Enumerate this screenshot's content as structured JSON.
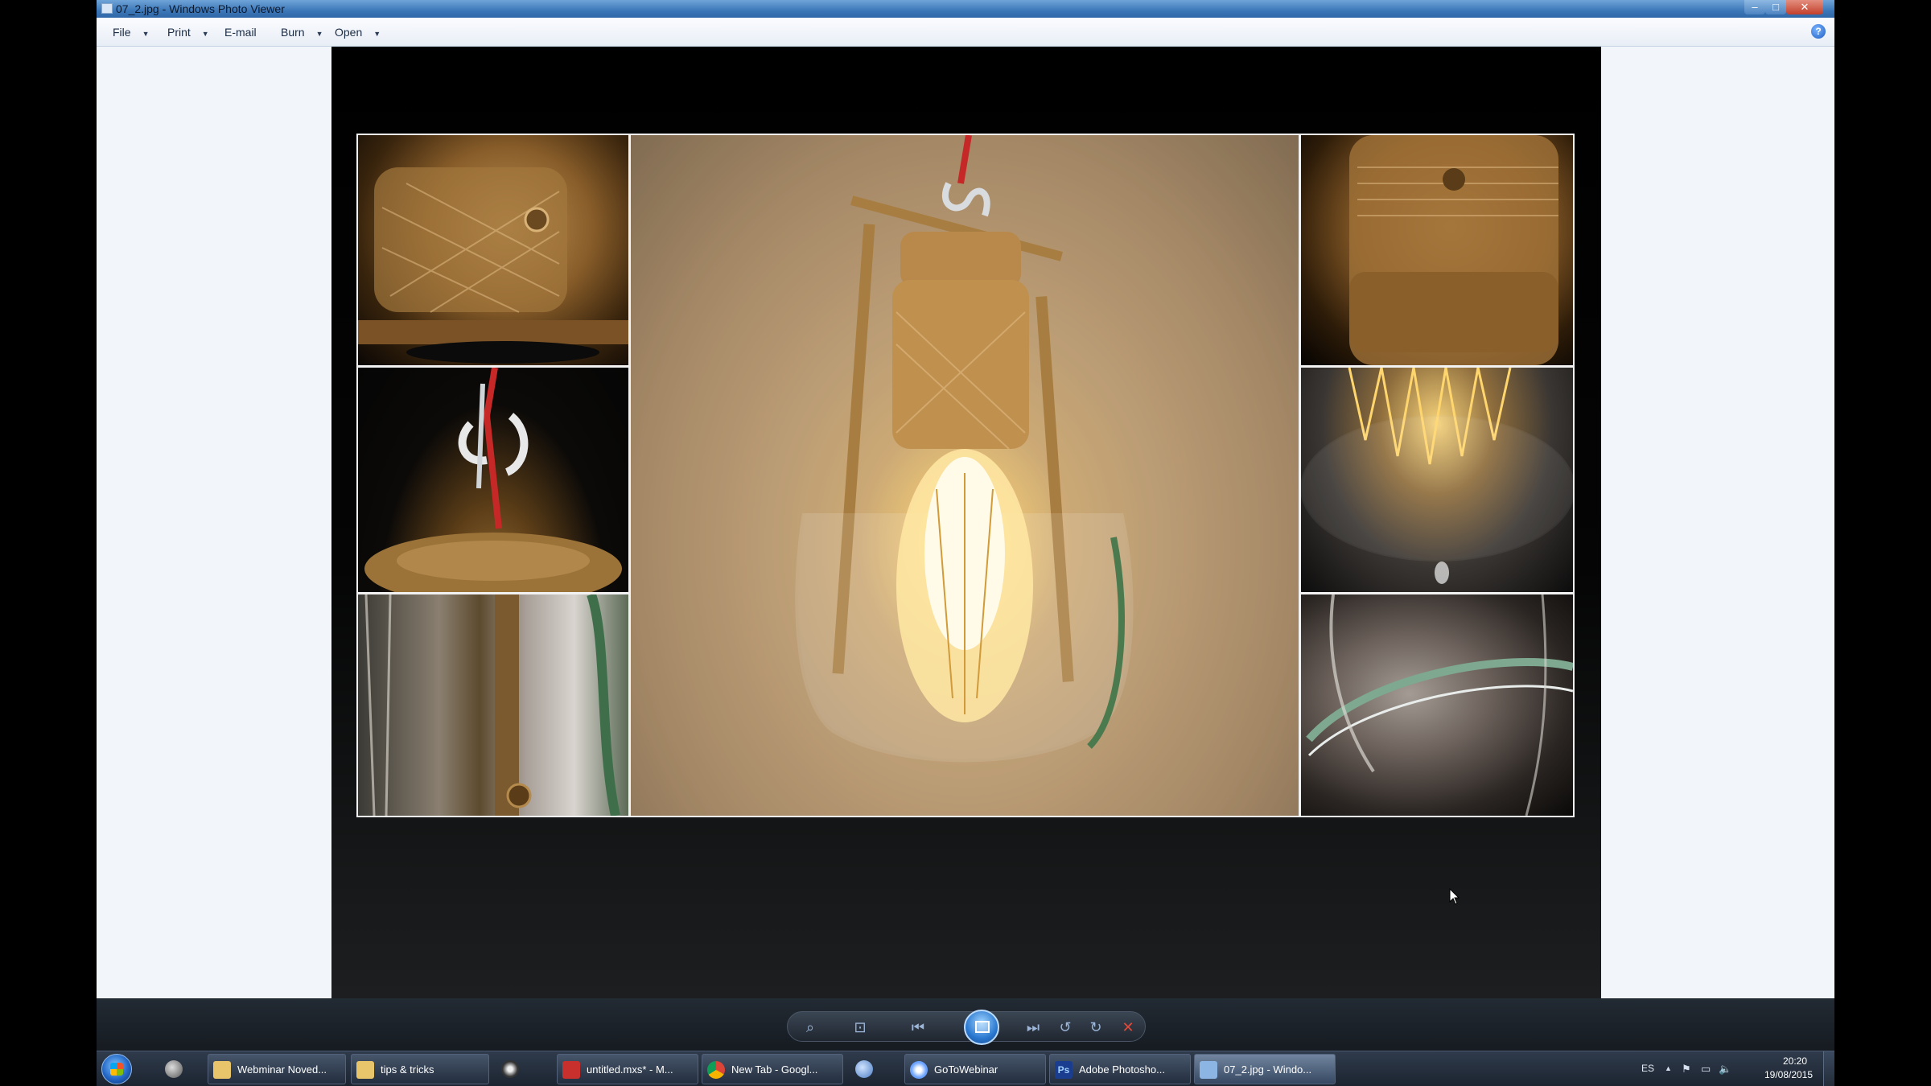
{
  "window": {
    "title": "07_2.jpg - Windows Photo Viewer",
    "minimize_glyph": "–",
    "maximize_glyph": "□",
    "close_glyph": "✕"
  },
  "menu": {
    "file": "File",
    "print": "Print",
    "email": "E-mail",
    "burn": "Burn",
    "open": "Open",
    "caret": "▼",
    "help_glyph": "?"
  },
  "toolbar": {
    "zoom_icon": "⌕",
    "fit_icon": "⊡",
    "prev_icon": "⏮",
    "next_icon": "⏭",
    "rotate_ccw_icon": "↺",
    "rotate_cw_icon": "↻",
    "delete_icon": "✕"
  },
  "taskbar": {
    "items": [
      {
        "label": "Webminar Noved...",
        "icon_color": "#e8c46a"
      },
      {
        "label": "tips & tricks",
        "icon_color": "#e8c46a"
      },
      {
        "label": "untitled.mxs* - M...",
        "icon_color": "#c7302d"
      },
      {
        "label": "New Tab - Googl...",
        "icon_color": "#4c8bf5"
      },
      {
        "label": "GoToWebinar",
        "icon_color": "#6aa2ff"
      },
      {
        "label": "Adobe Photosho...",
        "icon_color": "#1b3d8f"
      },
      {
        "label": "07_2.jpg - Windo...",
        "icon_color": "#8cb5e3"
      }
    ],
    "ps_badge": "Ps",
    "tray": {
      "language": "ES",
      "up_arrow": "▲",
      "flag": "⚑",
      "network": "▭",
      "volume": "🔈",
      "time": "20:20",
      "date": "19/08/2015"
    }
  }
}
